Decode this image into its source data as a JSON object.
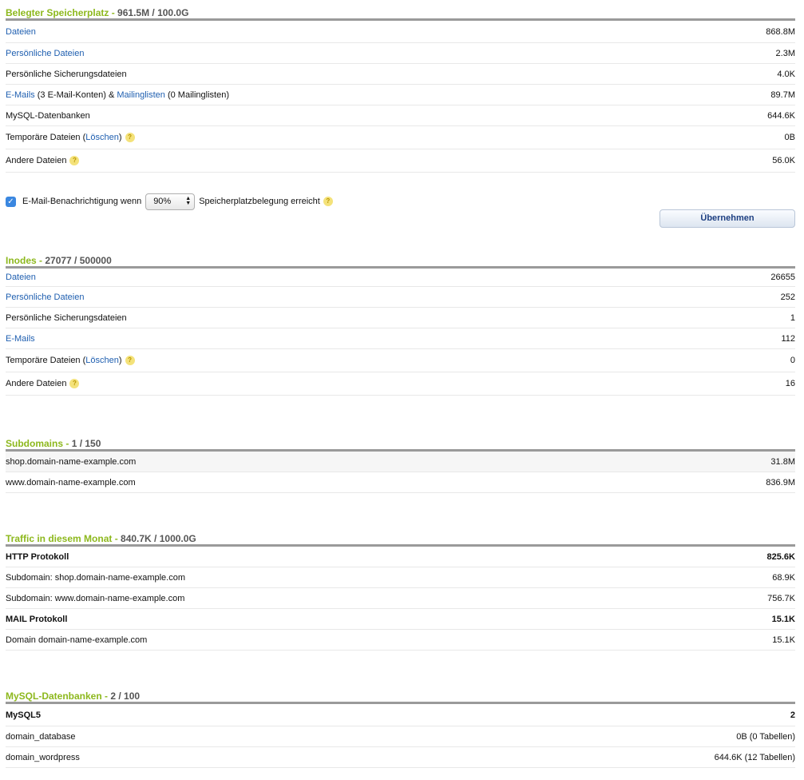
{
  "storage": {
    "title": "Belegter Speicherplatz",
    "sep": " - ",
    "value": "961.5M / 100.0G",
    "rows": {
      "files": {
        "label": "Dateien",
        "value": "868.8M"
      },
      "personal": {
        "label": "Persönliche Dateien",
        "value": "2.3M"
      },
      "backup": {
        "label": "Persönliche Sicherungsdateien",
        "value": "4.0K"
      },
      "email": {
        "link1": "E-Mails",
        "text1": " (3 E-Mail-Konten) & ",
        "link2": "Mailinglisten",
        "text2": " (0 Mailinglisten)",
        "value": "89.7M"
      },
      "mysql": {
        "label": "MySQL-Datenbanken",
        "value": "644.6K"
      },
      "temp": {
        "prefix": "Temporäre Dateien (",
        "link": "Löschen",
        "suffix": ")",
        "value": "0B"
      },
      "other": {
        "label": "Andere Dateien",
        "value": "56.0K"
      }
    },
    "notify": {
      "label_before": "E-Mail-Benachrichtigung wenn",
      "select_value": "90%",
      "label_after": "Speicherplatzbelegung erreicht",
      "checked": true
    },
    "apply_button": "Übernehmen"
  },
  "inodes": {
    "title": "Inodes",
    "sep": " - ",
    "value": "27077 / 500000",
    "rows": {
      "files": {
        "label": "Dateien",
        "value": "26655"
      },
      "personal": {
        "label": "Persönliche Dateien",
        "value": "252"
      },
      "backup": {
        "label": "Persönliche Sicherungsdateien",
        "value": "1"
      },
      "email": {
        "label": "E-Mails",
        "value": "112"
      },
      "temp": {
        "prefix": "Temporäre Dateien (",
        "link": "Löschen",
        "suffix": ")",
        "value": "0"
      },
      "other": {
        "label": "Andere Dateien",
        "value": "16"
      }
    }
  },
  "subdomains": {
    "title": "Subdomains",
    "sep": " - ",
    "value": "1 / 150",
    "rows": [
      {
        "label": "shop.domain-name-example.com",
        "value": "31.8M"
      },
      {
        "label": "www.domain-name-example.com",
        "value": "836.9M"
      }
    ]
  },
  "traffic": {
    "title": "Traffic in diesem Monat",
    "sep": " - ",
    "value": "840.7K / 1000.0G",
    "rows": [
      {
        "label": "HTTP Protokoll",
        "value": "825.6K"
      },
      {
        "label": "Subdomain: shop.domain-name-example.com",
        "value": "68.9K"
      },
      {
        "label": "Subdomain: www.domain-name-example.com",
        "value": "756.7K"
      },
      {
        "label": "MAIL Protokoll",
        "value": "15.1K"
      },
      {
        "label": "Domain domain-name-example.com",
        "value": "15.1K"
      }
    ]
  },
  "mysql": {
    "title": "MySQL-Datenbanken",
    "sep": " - ",
    "value": "2 / 100",
    "rows": [
      {
        "label": "MySQL5",
        "value": "2"
      },
      {
        "label": "domain_database",
        "value": "0B (0 Tabellen)"
      },
      {
        "label": "domain_wordpress",
        "value": "644.6K (12 Tabellen)"
      }
    ]
  },
  "icons": {
    "help": "?",
    "check": "✓",
    "select_up": "▲",
    "select_down": "▼"
  },
  "colors": {
    "title_green": "#8db81d",
    "link_blue": "#1f5fb0",
    "button_text": "#1d3f82",
    "help_yellow": "#f4e27a"
  }
}
